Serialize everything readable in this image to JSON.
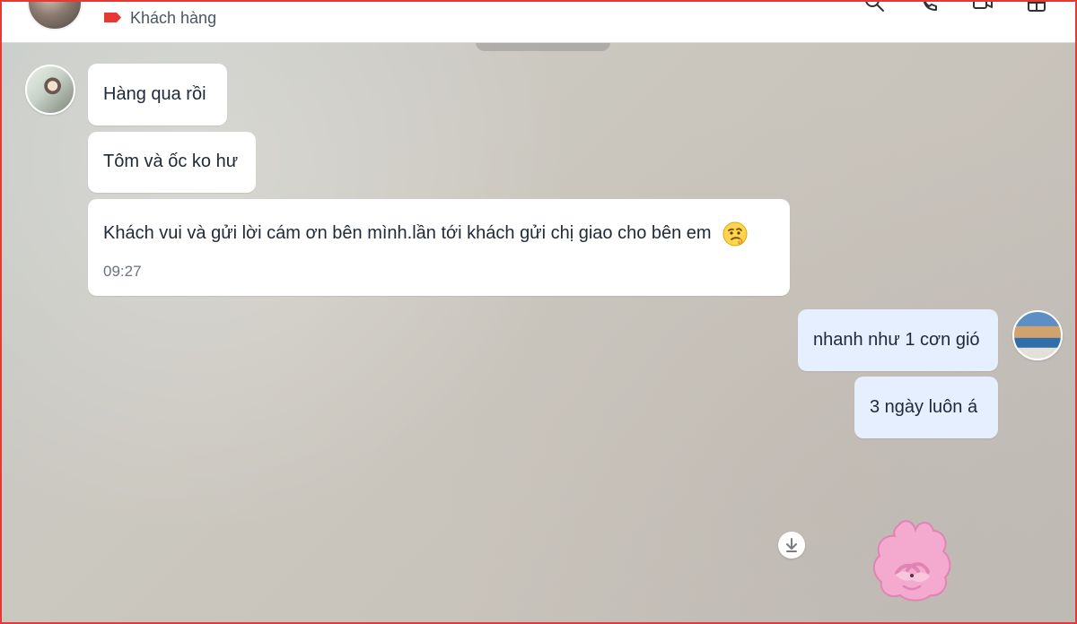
{
  "header": {
    "contact_label": "Khách hàng",
    "tag_icon": "label-tag-icon",
    "tools": [
      "search-icon",
      "call-icon",
      "video-icon",
      "layout-icon"
    ]
  },
  "chat": {
    "messages": [
      {
        "text": "Hàng qua rồi"
      },
      {
        "text": "Tôm và ốc ko hư"
      },
      {
        "text": "Khách vui và gửi lời cám ơn bên mình.lần tới khách gửi chị giao cho bên em",
        "emoji": "thinking-face-icon",
        "time": "09:27"
      },
      {
        "text": "nhanh như 1 cơn gió"
      },
      {
        "text": "3 ngày luôn á"
      }
    ],
    "attachment_icon": "download-icon",
    "sticker_icon": "pink-bunny-sticker"
  },
  "colors": {
    "accent_red": "#e53935",
    "outgoing_bubble": "#e5efff",
    "incoming_bubble": "#ffffff"
  }
}
